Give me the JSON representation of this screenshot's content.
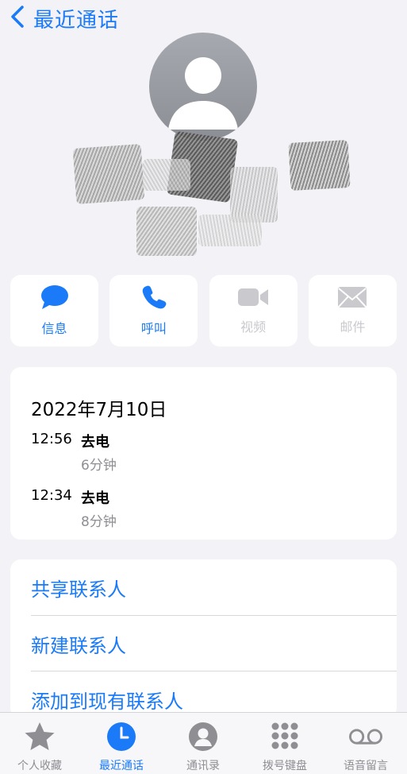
{
  "nav": {
    "back_label": "最近通话"
  },
  "actions": [
    {
      "label": "信息",
      "icon": "message-icon",
      "enabled": true
    },
    {
      "label": "呼叫",
      "icon": "phone-icon",
      "enabled": true
    },
    {
      "label": "视频",
      "icon": "video-icon",
      "enabled": false
    },
    {
      "label": "邮件",
      "icon": "mail-icon",
      "enabled": false
    }
  ],
  "history": {
    "date": "2022年7月10日",
    "calls": [
      {
        "time": "12:56",
        "type": "去电",
        "duration": "6分钟"
      },
      {
        "time": "12:34",
        "type": "去电",
        "duration": "8分钟"
      }
    ]
  },
  "menu": {
    "items": [
      {
        "label": "共享联系人"
      },
      {
        "label": "新建联系人"
      },
      {
        "label": "添加到现有联系人"
      }
    ]
  },
  "tabs": [
    {
      "label": "个人收藏",
      "icon": "star-icon",
      "active": false
    },
    {
      "label": "最近通话",
      "icon": "clock-icon",
      "active": true
    },
    {
      "label": "通讯录",
      "icon": "contact-icon",
      "active": false
    },
    {
      "label": "拨号键盘",
      "icon": "keypad-icon",
      "active": false
    },
    {
      "label": "语音留言",
      "icon": "voicemail-icon",
      "active": false
    }
  ],
  "colors": {
    "accent": "#1a7af8",
    "disabled": "#c9c9ce",
    "background": "#f2f2f7",
    "secondary_text": "#8e8e93"
  }
}
